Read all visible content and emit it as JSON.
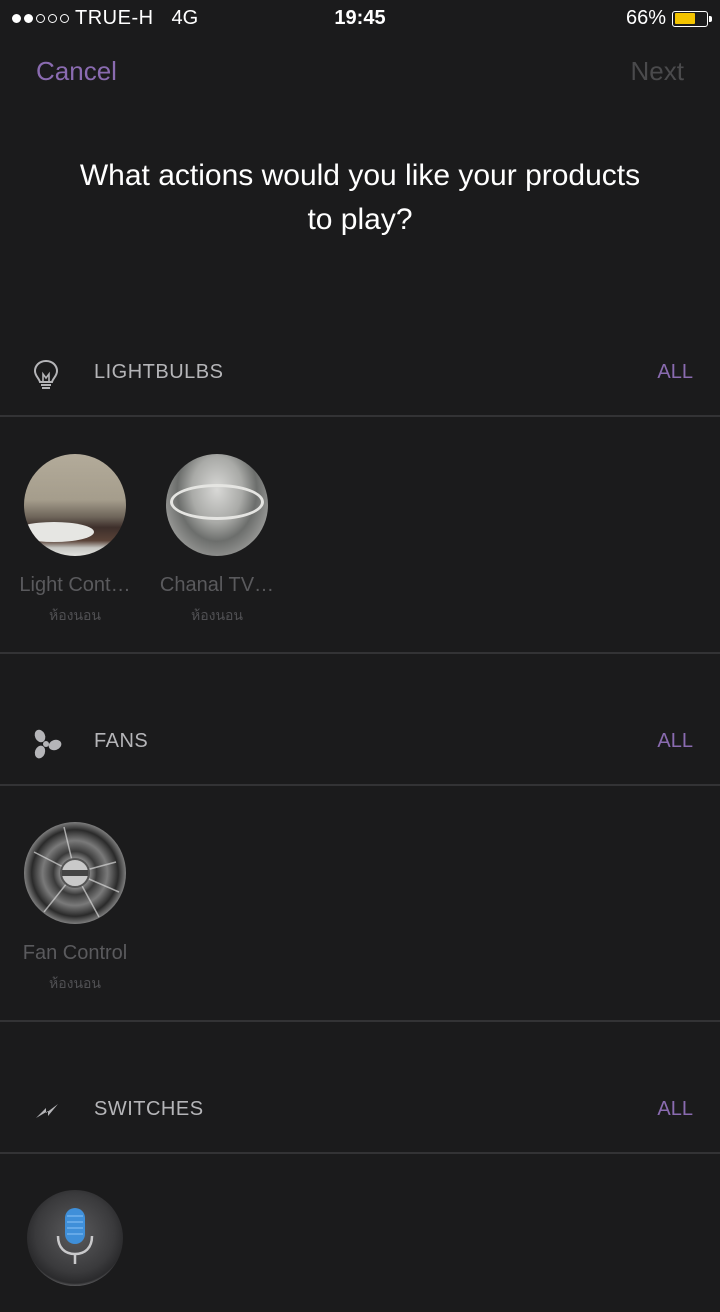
{
  "status_bar": {
    "carrier": "TRUE-H",
    "network": "4G",
    "time": "19:45",
    "battery_percent": "66%",
    "battery_level": 0.66,
    "signal_strength": 2
  },
  "nav": {
    "cancel_label": "Cancel",
    "next_label": "Next"
  },
  "question": {
    "line1": "What actions would you like your products",
    "line2": "to play?"
  },
  "sections": [
    {
      "title": "LIGHTBULBS",
      "all_label": "ALL",
      "icon": "lightbulb-icon",
      "devices": [
        {
          "name": "Light Cont…",
          "room": "ห้องนอน"
        },
        {
          "name": "Chanal TV…",
          "room": "ห้องนอน"
        }
      ]
    },
    {
      "title": "FANS",
      "all_label": "ALL",
      "icon": "fan-icon",
      "devices": [
        {
          "name": "Fan Control",
          "room": "ห้องนอน"
        }
      ]
    },
    {
      "title": "SWITCHES",
      "all_label": "ALL",
      "icon": "lightning-icon",
      "devices": [
        {
          "name": "",
          "room": ""
        }
      ]
    }
  ],
  "colors": {
    "accent": "#8a6bb0",
    "background": "#1b1b1c",
    "battery": "#f3c400"
  }
}
